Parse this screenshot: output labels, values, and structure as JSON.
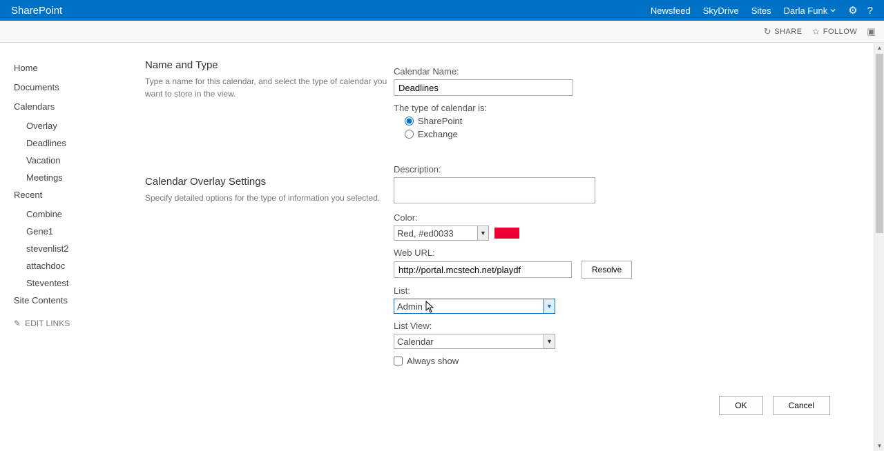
{
  "suite": {
    "brand": "SharePoint",
    "links": [
      "Newsfeed",
      "SkyDrive",
      "Sites"
    ],
    "user": "Darla Funk"
  },
  "ribbon": {
    "share": "SHARE",
    "follow": "FOLLOW"
  },
  "quicklaunch": {
    "home": "Home",
    "documents": "Documents",
    "calendars": "Calendars",
    "cal_items": [
      "Overlay",
      "Deadlines",
      "Vacation",
      "Meetings"
    ],
    "recent": "Recent",
    "recent_items": [
      "Combine",
      "Gene1",
      "stevenlist2",
      "attachdoc",
      "Steventest"
    ],
    "site_contents": "Site Contents",
    "edit_links": "EDIT LINKS"
  },
  "sections": {
    "name_type_title": "Name and Type",
    "name_type_desc": "Type a name for this calendar, and select the type of calendar you want to store in the view.",
    "overlay_title": "Calendar Overlay Settings",
    "overlay_desc": "Specify detailed options for the type of information you selected."
  },
  "form": {
    "calendar_name_label": "Calendar Name:",
    "calendar_name_value": "Deadlines",
    "type_label": "The type of calendar is:",
    "type_sharepoint": "SharePoint",
    "type_exchange": "Exchange",
    "description_label": "Description:",
    "description_value": "",
    "color_label": "Color:",
    "color_value": "Red, #ed0033",
    "color_hex": "#ed0033",
    "weburl_label": "Web URL:",
    "weburl_value": "http://portal.mcstech.net/playdf",
    "resolve_label": "Resolve",
    "list_label": "List:",
    "list_value": "Admin",
    "listview_label": "List View:",
    "listview_value": "Calendar",
    "always_show_label": "Always show",
    "always_show_checked": false
  },
  "buttons": {
    "ok": "OK",
    "cancel": "Cancel"
  }
}
